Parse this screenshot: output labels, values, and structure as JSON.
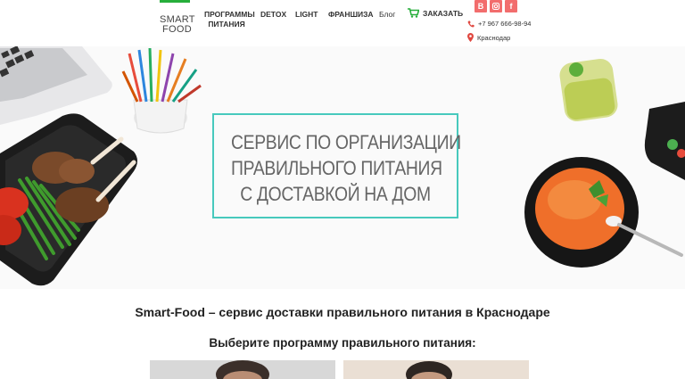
{
  "header": {
    "logo_line1": "SMART",
    "logo_line2": "FOOD",
    "nav": {
      "programs_line1": "ПРОГРАММЫ",
      "programs_line2": "ПИТАНИЯ",
      "detox": "DETOX",
      "light": "LIGHT",
      "franchise": "ФРАНШИЗА",
      "blog": "Блог",
      "order": "ЗАКАЗАТЬ"
    },
    "social": {
      "vk": "B",
      "instagram": "◙",
      "facebook": "f"
    },
    "phone": "+7 967 666-98-94",
    "city": "Краснодар"
  },
  "hero": {
    "line1": "СЕРВИС ПО ОРГАНИЗАЦИИ",
    "line2": "ПРАВИЛЬНОГО ПИТАНИЯ",
    "line3": "С ДОСТАВКОЙ НА ДОМ"
  },
  "main": {
    "tagline": "Smart-Food – сервис доставки правильного питания в Краснодаре",
    "choose_program": "Выберите программу правильного питания:"
  },
  "colors": {
    "brand_green": "#27ae3b",
    "frame_teal": "#47c9bd",
    "social_coral": "#f26d6d"
  }
}
